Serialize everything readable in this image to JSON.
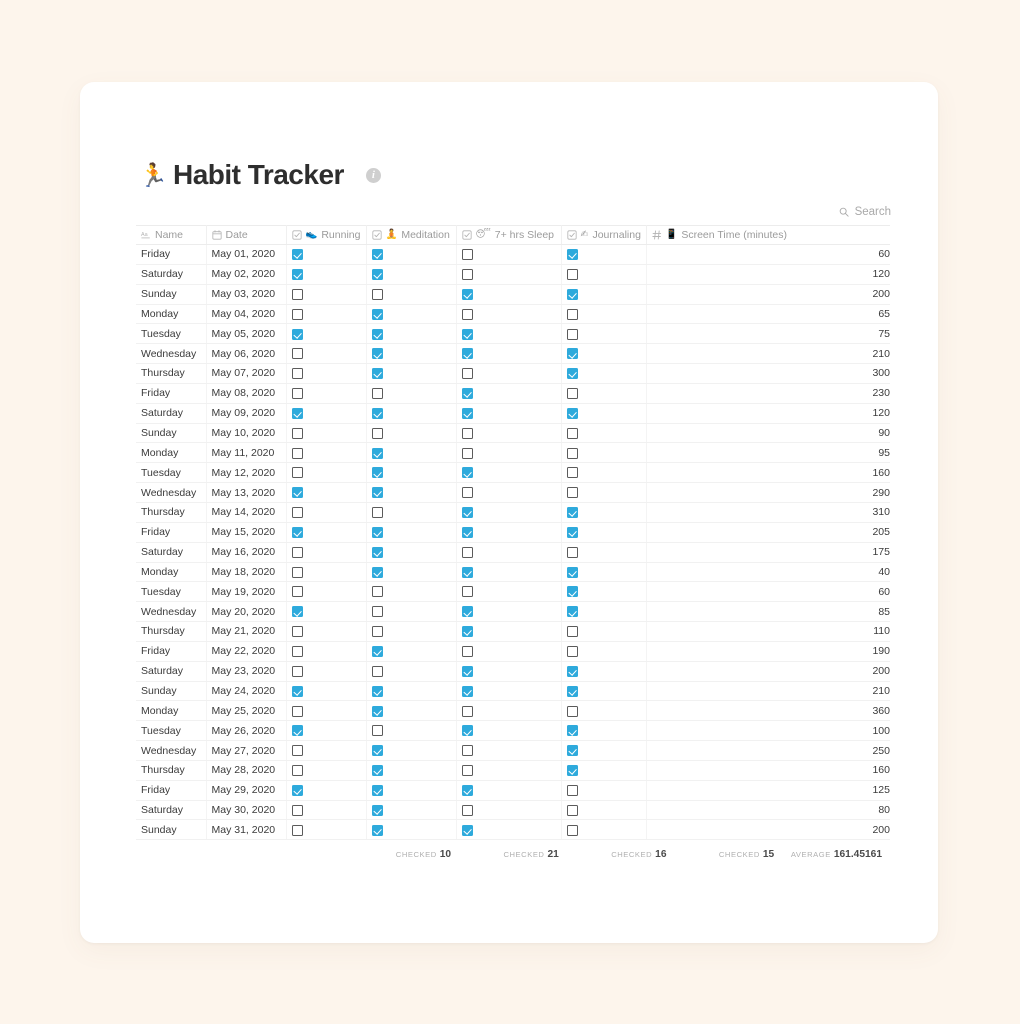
{
  "page": {
    "background_color": "#fdf5ec",
    "card_color": "#ffffff"
  },
  "header": {
    "emoji": "🏃",
    "emoji_name": "running-person-emoji",
    "title": "Habit Tracker",
    "info_glyph": "i"
  },
  "search": {
    "icon": "search-icon",
    "placeholder": "Search",
    "label": "Search"
  },
  "accent": {
    "checkbox_checked": "#2eaadc",
    "checkbox_unchecked_border": "#5b5b5b"
  },
  "table": {
    "columns": [
      {
        "key": "name",
        "label": "Name",
        "type_icon": "aa-text-icon",
        "emoji": ""
      },
      {
        "key": "date",
        "label": "Date",
        "type_icon": "calendar-icon",
        "emoji": ""
      },
      {
        "key": "run",
        "label": "Running",
        "type_icon": "checkbox-icon",
        "emoji": "👟"
      },
      {
        "key": "med",
        "label": "Meditation",
        "type_icon": "checkbox-icon",
        "emoji": "🧘"
      },
      {
        "key": "sleep",
        "label": "7+ hrs Sleep",
        "type_icon": "checkbox-icon",
        "emoji": "😴"
      },
      {
        "key": "jour",
        "label": "Journaling",
        "type_icon": "checkbox-icon",
        "emoji": "✍"
      },
      {
        "key": "screen",
        "label": "Screen Time (minutes)",
        "type_icon": "number-hash-icon",
        "emoji": "📱"
      }
    ],
    "rows": [
      {
        "name": "Friday",
        "date": "May 01, 2020",
        "run": true,
        "med": true,
        "sleep": false,
        "jour": true,
        "screen": "60"
      },
      {
        "name": "Saturday",
        "date": "May 02, 2020",
        "run": true,
        "med": true,
        "sleep": false,
        "jour": false,
        "screen": "120"
      },
      {
        "name": "Sunday",
        "date": "May 03, 2020",
        "run": false,
        "med": false,
        "sleep": true,
        "jour": true,
        "screen": "200"
      },
      {
        "name": "Monday",
        "date": "May 04, 2020",
        "run": false,
        "med": true,
        "sleep": false,
        "jour": false,
        "screen": "65"
      },
      {
        "name": "Tuesday",
        "date": "May 05, 2020",
        "run": true,
        "med": true,
        "sleep": true,
        "jour": false,
        "screen": "75"
      },
      {
        "name": "Wednesday",
        "date": "May 06, 2020",
        "run": false,
        "med": true,
        "sleep": true,
        "jour": true,
        "screen": "210"
      },
      {
        "name": "Thursday",
        "date": "May 07, 2020",
        "run": false,
        "med": true,
        "sleep": false,
        "jour": true,
        "screen": "300"
      },
      {
        "name": "Friday",
        "date": "May 08, 2020",
        "run": false,
        "med": false,
        "sleep": true,
        "jour": false,
        "screen": "230"
      },
      {
        "name": "Saturday",
        "date": "May 09, 2020",
        "run": true,
        "med": true,
        "sleep": true,
        "jour": true,
        "screen": "120"
      },
      {
        "name": "Sunday",
        "date": "May 10, 2020",
        "run": false,
        "med": false,
        "sleep": false,
        "jour": false,
        "screen": "90"
      },
      {
        "name": "Monday",
        "date": "May 11, 2020",
        "run": false,
        "med": true,
        "sleep": false,
        "jour": false,
        "screen": "95"
      },
      {
        "name": "Tuesday",
        "date": "May 12, 2020",
        "run": false,
        "med": true,
        "sleep": true,
        "jour": false,
        "screen": "160"
      },
      {
        "name": "Wednesday",
        "date": "May 13, 2020",
        "run": true,
        "med": true,
        "sleep": false,
        "jour": false,
        "screen": "290"
      },
      {
        "name": "Thursday",
        "date": "May 14, 2020",
        "run": false,
        "med": false,
        "sleep": true,
        "jour": true,
        "screen": "310"
      },
      {
        "name": "Friday",
        "date": "May 15, 2020",
        "run": true,
        "med": true,
        "sleep": true,
        "jour": true,
        "screen": "205"
      },
      {
        "name": "Saturday",
        "date": "May 16, 2020",
        "run": false,
        "med": true,
        "sleep": false,
        "jour": false,
        "screen": "175"
      },
      {
        "name": "Monday",
        "date": "May 18, 2020",
        "run": false,
        "med": true,
        "sleep": true,
        "jour": true,
        "screen": "40"
      },
      {
        "name": "Tuesday",
        "date": "May 19, 2020",
        "run": false,
        "med": false,
        "sleep": false,
        "jour": true,
        "screen": "60"
      },
      {
        "name": "Wednesday",
        "date": "May 20, 2020",
        "run": true,
        "med": false,
        "sleep": true,
        "jour": true,
        "screen": "85"
      },
      {
        "name": "Thursday",
        "date": "May 21, 2020",
        "run": false,
        "med": false,
        "sleep": true,
        "jour": false,
        "screen": "110"
      },
      {
        "name": "Friday",
        "date": "May 22, 2020",
        "run": false,
        "med": true,
        "sleep": false,
        "jour": false,
        "screen": "190"
      },
      {
        "name": "Saturday",
        "date": "May 23, 2020",
        "run": false,
        "med": false,
        "sleep": true,
        "jour": true,
        "screen": "200"
      },
      {
        "name": "Sunday",
        "date": "May 24, 2020",
        "run": true,
        "med": true,
        "sleep": true,
        "jour": true,
        "screen": "210"
      },
      {
        "name": "Monday",
        "date": "May 25, 2020",
        "run": false,
        "med": true,
        "sleep": false,
        "jour": false,
        "screen": "360"
      },
      {
        "name": "Tuesday",
        "date": "May 26, 2020",
        "run": true,
        "med": false,
        "sleep": true,
        "jour": true,
        "screen": "100"
      },
      {
        "name": "Wednesday",
        "date": "May 27, 2020",
        "run": false,
        "med": true,
        "sleep": false,
        "jour": true,
        "screen": "250"
      },
      {
        "name": "Thursday",
        "date": "May 28, 2020",
        "run": false,
        "med": true,
        "sleep": false,
        "jour": true,
        "screen": "160"
      },
      {
        "name": "Friday",
        "date": "May 29, 2020",
        "run": true,
        "med": true,
        "sleep": true,
        "jour": false,
        "screen": "125"
      },
      {
        "name": "Saturday",
        "date": "May 30, 2020",
        "run": false,
        "med": true,
        "sleep": false,
        "jour": false,
        "screen": "80"
      },
      {
        "name": "Sunday",
        "date": "May 31, 2020",
        "run": false,
        "med": true,
        "sleep": true,
        "jour": false,
        "screen": "200"
      }
    ],
    "summary": [
      {
        "key": "name",
        "label": "",
        "value": ""
      },
      {
        "key": "date",
        "label": "",
        "value": ""
      },
      {
        "key": "run",
        "label": "Checked",
        "value": "10"
      },
      {
        "key": "med",
        "label": "Checked",
        "value": "21"
      },
      {
        "key": "sleep",
        "label": "Checked",
        "value": "16"
      },
      {
        "key": "jour",
        "label": "Checked",
        "value": "15"
      },
      {
        "key": "screen",
        "label": "Average",
        "value": "161.45161"
      }
    ]
  }
}
